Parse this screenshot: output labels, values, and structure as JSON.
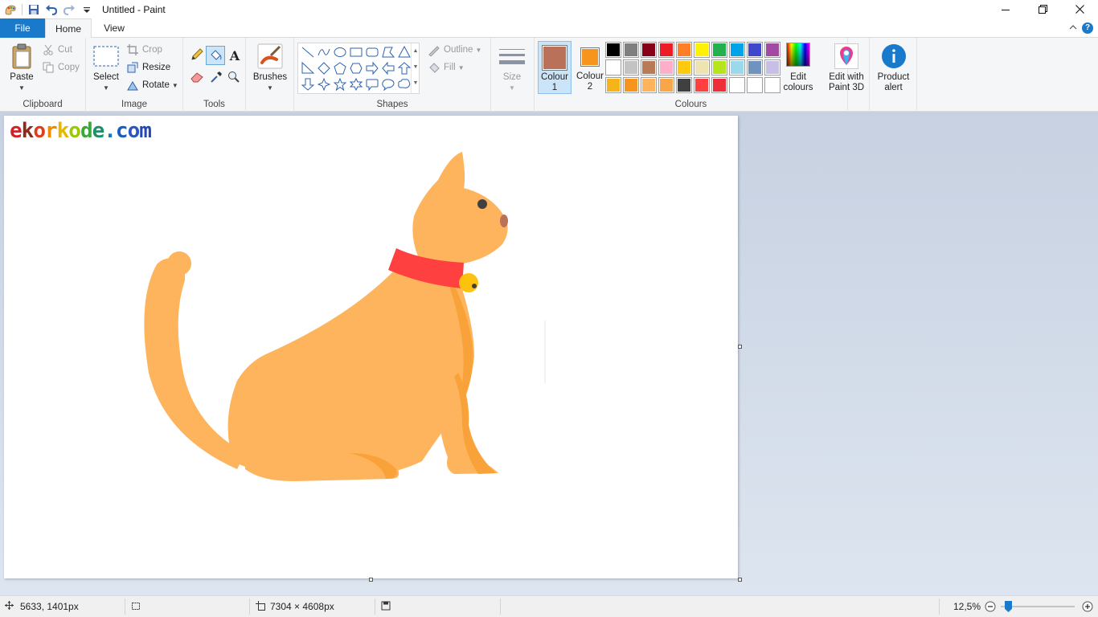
{
  "window": {
    "title": "Untitled - Paint"
  },
  "tabs": {
    "file": "File",
    "home": "Home",
    "view": "View"
  },
  "clipboard": {
    "paste": "Paste",
    "cut": "Cut",
    "copy": "Copy",
    "group": "Clipboard"
  },
  "image": {
    "select": "Select",
    "crop": "Crop",
    "resize": "Resize",
    "rotate": "Rotate",
    "group": "Image"
  },
  "tools": {
    "group": "Tools"
  },
  "brushes": {
    "label": "Brushes"
  },
  "shapes": {
    "outline": "Outline",
    "fill": "Fill",
    "group": "Shapes"
  },
  "size": {
    "label": "Size"
  },
  "colours": {
    "colour1_line1": "Colour",
    "colour1_line2": "1",
    "colour2_line1": "Colour",
    "colour2_line2": "2",
    "colour1_value": "#b9715a",
    "colour2_value": "#f7941d",
    "edit_line1": "Edit",
    "edit_line2": "colours",
    "group": "Colours",
    "palette": [
      "#000000",
      "#7f7f7f",
      "#880015",
      "#ed1c24",
      "#ff7f27",
      "#fff200",
      "#22b14c",
      "#00a2e8",
      "#3f48cc",
      "#a349a4",
      "#ffffff",
      "#c3c3c3",
      "#b97a57",
      "#ffaec9",
      "#ffc90e",
      "#efe4b0",
      "#b5e61d",
      "#99d9ea",
      "#7092be",
      "#c8bfe7",
      "#f5b41c",
      "#f7941d",
      "#fdb45c",
      "#f9a54a",
      "#404040",
      "#ff4040",
      "#ed2d38",
      "#ffffff",
      "#ffffff",
      "#ffffff"
    ]
  },
  "paint3d": {
    "line1": "Edit with",
    "line2": "Paint 3D"
  },
  "product": {
    "line1": "Product",
    "line2": "alert"
  },
  "canvas": {
    "watermark_letters": [
      "e",
      "k",
      "o",
      "r",
      "k",
      "o",
      "d",
      "e",
      ".",
      "c",
      "o",
      "m"
    ],
    "watermark_colors": [
      "#d0222a",
      "#8a2b1e",
      "#e23d1b",
      "#f08a00",
      "#e6b800",
      "#9cc900",
      "#3aa83a",
      "#1f8f6a",
      "#1777c0",
      "#1a5fbf",
      "#2b56c0",
      "#2448b0"
    ]
  },
  "status": {
    "position": "5633, 1401px",
    "dimensions": "7304 × 4608px",
    "zoom": "12,5%"
  }
}
